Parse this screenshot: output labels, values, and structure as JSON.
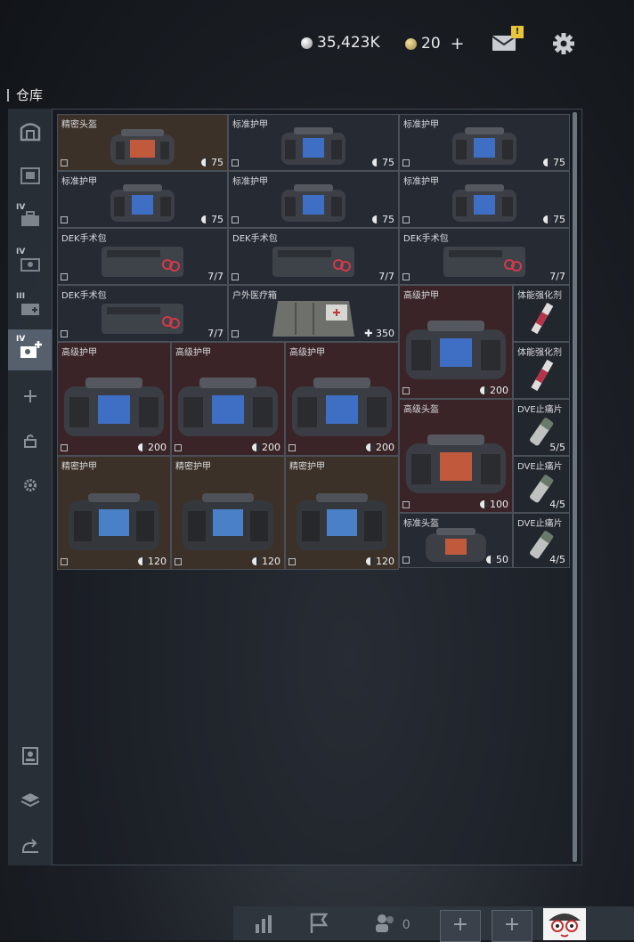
{
  "header": {
    "silver_amount": "35,423K",
    "gold_amount": "20",
    "plus_label": "+",
    "mail_badge": "!"
  },
  "section": {
    "title": "仓库"
  },
  "sidebar": {
    "items": [
      {
        "name": "all-icon",
        "tier": ""
      },
      {
        "name": "tier-iv-bag-icon",
        "tier": ""
      },
      {
        "name": "tier-iv-case-icon",
        "tier": "IV"
      },
      {
        "name": "tier-iv-box-icon",
        "tier": "IV"
      },
      {
        "name": "tier-iii-box-icon",
        "tier": "III"
      },
      {
        "name": "tier-iv-add-icon",
        "tier": "IV"
      },
      {
        "name": "add-icon",
        "tier": ""
      },
      {
        "name": "lock-icon",
        "tier": ""
      },
      {
        "name": "gear-icon",
        "tier": ""
      }
    ],
    "bottom": [
      {
        "name": "person-card-icon"
      },
      {
        "name": "layers-icon"
      },
      {
        "name": "sort-icon"
      }
    ]
  },
  "inventory": {
    "items": [
      {
        "name": "精密头盔",
        "value": "75",
        "kind": "helmet",
        "rarity": "brown"
      },
      {
        "name": "标准护甲",
        "value": "75",
        "kind": "armor",
        "rarity": "normal"
      },
      {
        "name": "标准护甲",
        "value": "75",
        "kind": "armor",
        "rarity": "normal"
      },
      {
        "name": "标准护甲",
        "value": "75",
        "kind": "armor",
        "rarity": "normal"
      },
      {
        "name": "标准护甲",
        "value": "75",
        "kind": "armor",
        "rarity": "normal"
      },
      {
        "name": "标准护甲",
        "value": "75",
        "kind": "armor",
        "rarity": "normal"
      },
      {
        "name": "DEK手术包",
        "value": "7/7",
        "kind": "kit",
        "rarity": "normal"
      },
      {
        "name": "DEK手术包",
        "value": "7/7",
        "kind": "kit",
        "rarity": "normal"
      },
      {
        "name": "DEK手术包",
        "value": "7/7",
        "kind": "kit",
        "rarity": "normal"
      },
      {
        "name": "DEK手术包",
        "value": "7/7",
        "kind": "kit",
        "rarity": "normal"
      },
      {
        "name": "户外医疗箱",
        "value": "350",
        "kind": "medbox",
        "rarity": "normal"
      },
      {
        "name": "高级护甲",
        "value": "200",
        "kind": "armor",
        "rarity": "red"
      },
      {
        "name": "体能强化剂",
        "value": "",
        "kind": "syringe",
        "rarity": "normal"
      },
      {
        "name": "体能强化剂",
        "value": "",
        "kind": "syringe",
        "rarity": "normal"
      },
      {
        "name": "高级护甲",
        "value": "200",
        "kind": "armor",
        "rarity": "red"
      },
      {
        "name": "高级护甲",
        "value": "200",
        "kind": "armor",
        "rarity": "red"
      },
      {
        "name": "高级护甲",
        "value": "200",
        "kind": "armor",
        "rarity": "red"
      },
      {
        "name": "高级头盔",
        "value": "100",
        "kind": "helmet",
        "rarity": "red"
      },
      {
        "name": "DVE止痛片",
        "value": "5/5",
        "kind": "pills",
        "rarity": "normal"
      },
      {
        "name": "DVE止痛片",
        "value": "4/5",
        "kind": "pills",
        "rarity": "normal"
      },
      {
        "name": "精密护甲",
        "value": "120",
        "kind": "armor",
        "rarity": "brown"
      },
      {
        "name": "精密护甲",
        "value": "120",
        "kind": "armor",
        "rarity": "brown"
      },
      {
        "name": "精密护甲",
        "value": "120",
        "kind": "armor",
        "rarity": "brown"
      },
      {
        "name": "标准头盔",
        "value": "50",
        "kind": "helmet",
        "rarity": "normal"
      },
      {
        "name": "DVE止痛片",
        "value": "4/5",
        "kind": "pills",
        "rarity": "normal"
      }
    ]
  },
  "bottombar": {
    "team_count": "0",
    "add_slot_1": "+",
    "add_slot_2": "+"
  }
}
